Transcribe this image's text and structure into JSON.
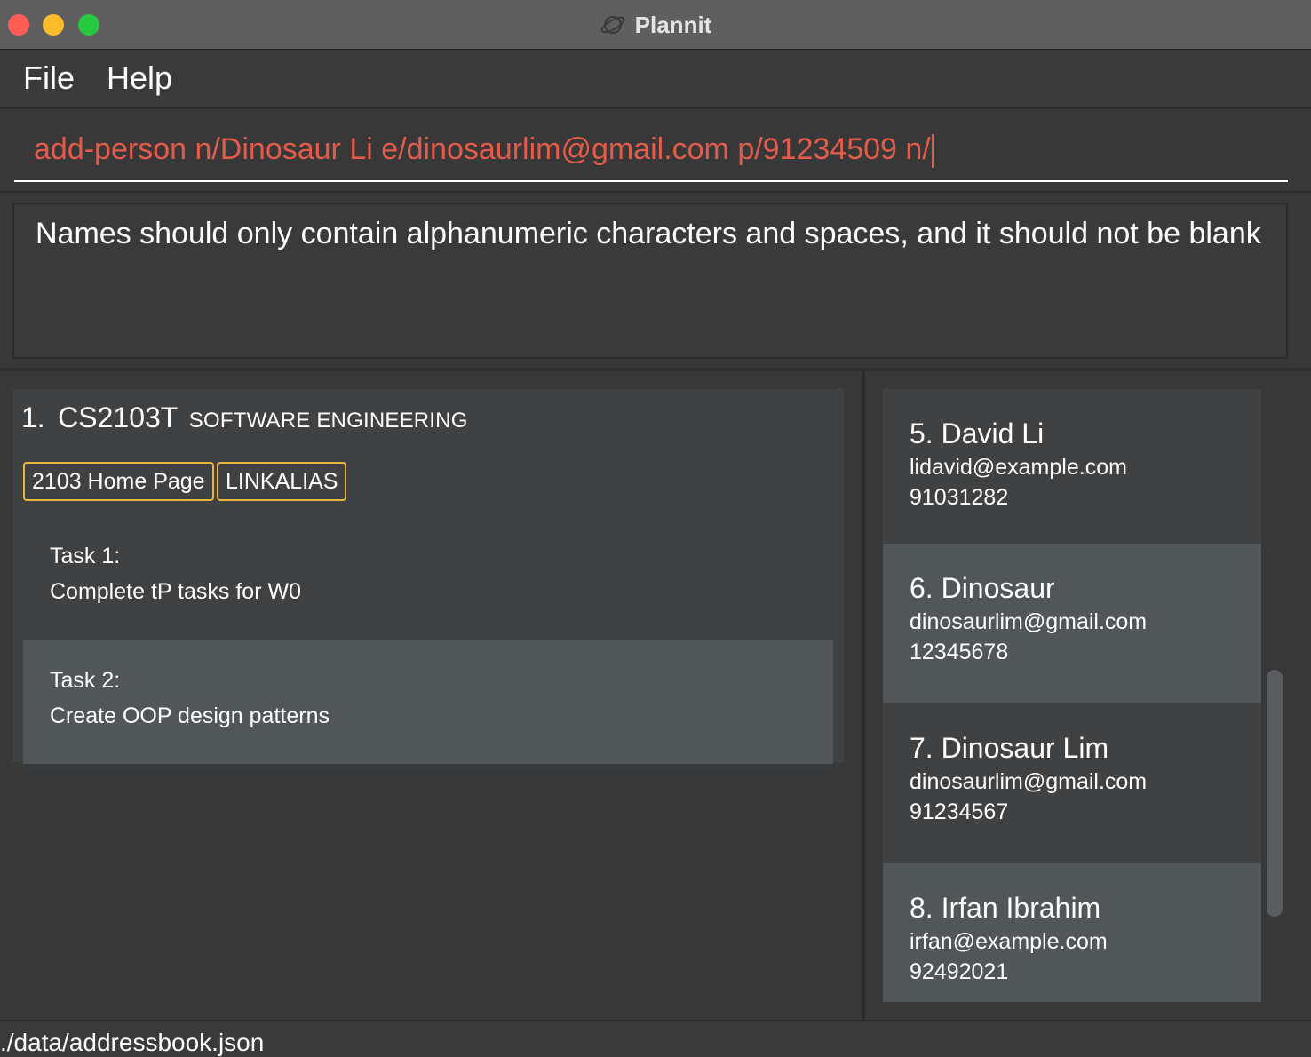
{
  "window": {
    "title": "Plannit",
    "app_icon": "planet-icon"
  },
  "menu": {
    "file_label": "File",
    "help_label": "Help"
  },
  "command": {
    "value": "add-person n/Dinosaur Li e/dinosaurlim@gmail.com p/91234509 n/"
  },
  "result": {
    "message": "Names should only contain alphanumeric characters and spaces, and it should not be blank"
  },
  "module": {
    "index": "1.",
    "code": "CS2103T",
    "title": "SOFTWARE ENGINEERING",
    "links": [
      "2103 Home Page",
      "LINKALIAS"
    ],
    "tasks": [
      {
        "label": "Task 1:",
        "description": "Complete tP tasks for W0"
      },
      {
        "label": "Task 2:",
        "description": "Create OOP design patterns"
      }
    ]
  },
  "persons": [
    {
      "index": "5.",
      "name": "David Li",
      "email": "lidavid@example.com",
      "phone": "91031282"
    },
    {
      "index": "6.",
      "name": "Dinosaur",
      "email": "dinosaurlim@gmail.com",
      "phone": "12345678"
    },
    {
      "index": "7.",
      "name": "Dinosaur Lim",
      "email": "dinosaurlim@gmail.com",
      "phone": "91234567"
    },
    {
      "index": "8.",
      "name": "Irfan Ibrahim",
      "email": "irfan@example.com",
      "phone": "92492021"
    }
  ],
  "status": {
    "path": "./data/addressbook.json"
  },
  "colors": {
    "error_text": "#e35b4a",
    "tag_border": "#e8b63a"
  }
}
